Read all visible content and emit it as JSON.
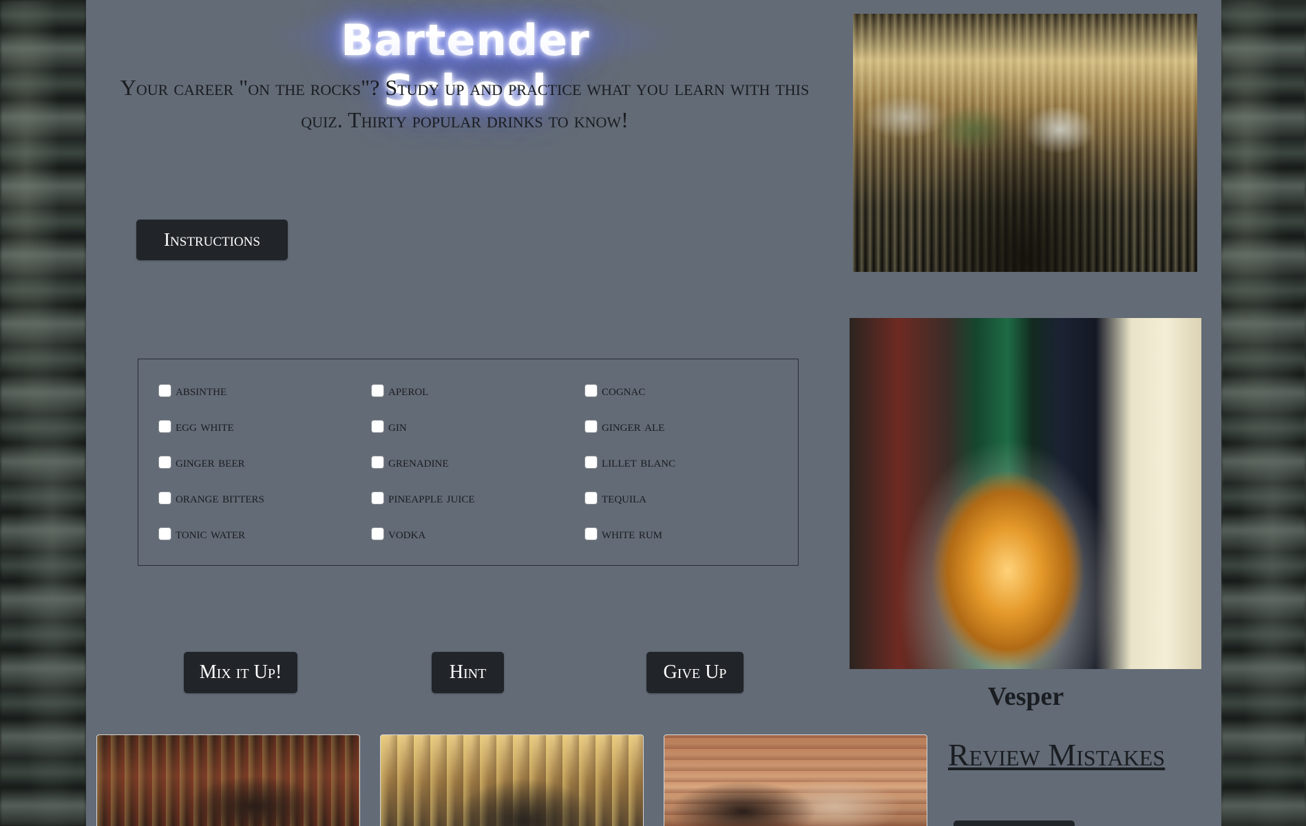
{
  "header": {
    "title": "Bartender School",
    "subtitle": "Your career \"on the rocks\"? Study up and practice what you learn with this quiz. Thirty popular drinks to know!"
  },
  "buttons": {
    "instructions": "Instructions",
    "mix": "Mix it Up!",
    "hint": "Hint",
    "give_up": "Give Up"
  },
  "ingredients": [
    {
      "label": "absinthe",
      "checked": false
    },
    {
      "label": "aperol",
      "checked": false
    },
    {
      "label": "cognac",
      "checked": false
    },
    {
      "label": "egg white",
      "checked": false
    },
    {
      "label": "gin",
      "checked": false
    },
    {
      "label": "ginger ale",
      "checked": false
    },
    {
      "label": "ginger beer",
      "checked": false
    },
    {
      "label": "grenadine",
      "checked": false
    },
    {
      "label": "lillet blanc",
      "checked": false
    },
    {
      "label": "orange bitters",
      "checked": false
    },
    {
      "label": "pineapple juice",
      "checked": false
    },
    {
      "label": "tequila",
      "checked": false
    },
    {
      "label": "tonic water",
      "checked": false
    },
    {
      "label": "vodka",
      "checked": false
    },
    {
      "label": "white rum",
      "checked": false
    }
  ],
  "drink": {
    "name": "Vesper"
  },
  "review": {
    "label": "Review Mistakes"
  },
  "colors": {
    "panel": "#636b76",
    "button": "#212529",
    "text": "#1a1d21",
    "title_glow": "#4a5cff"
  }
}
